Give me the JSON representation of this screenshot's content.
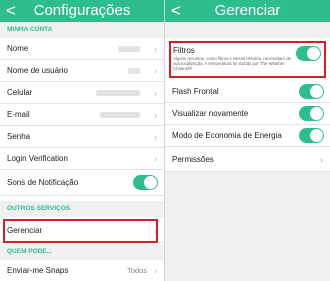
{
  "left": {
    "title": "Configurações",
    "back_glyph": "<",
    "sections": {
      "account": "MINHA CONTA",
      "other": "OUTROS SERVIÇOS",
      "who": "QUEM PODE..."
    },
    "rows": {
      "nome": "Nome",
      "username": "Nome de usuário",
      "celular": "Celular",
      "email": "E-mail",
      "senha": "Senha",
      "login": "Login Verification",
      "sons": "Sons de Notificação",
      "gerenciar": "Gerenciar",
      "snaps": "Enviar-me Snaps",
      "snaps_value": "Todos"
    },
    "sons_enabled": true
  },
  "right": {
    "title": "Gerenciar",
    "back_glyph": "<",
    "filtros": {
      "label": "Filtros",
      "desc": "Alguns recursos, como filtros e Nossa História, necessitam de sua localização. A temperatura foi trazida por The Weather Channel®",
      "enabled": true
    },
    "rows": {
      "flash": "Flash Frontal",
      "replay": "Visualizar novamente",
      "economy": "Modo de Economia de Energia",
      "permissions": "Permissões"
    },
    "toggles": {
      "flash": true,
      "replay": true,
      "economy": true
    }
  },
  "chevron_glyph": "›",
  "colors": {
    "accent": "#2ebd8e",
    "highlight": "#d81f26",
    "section_bg": "#f0f0f0"
  }
}
